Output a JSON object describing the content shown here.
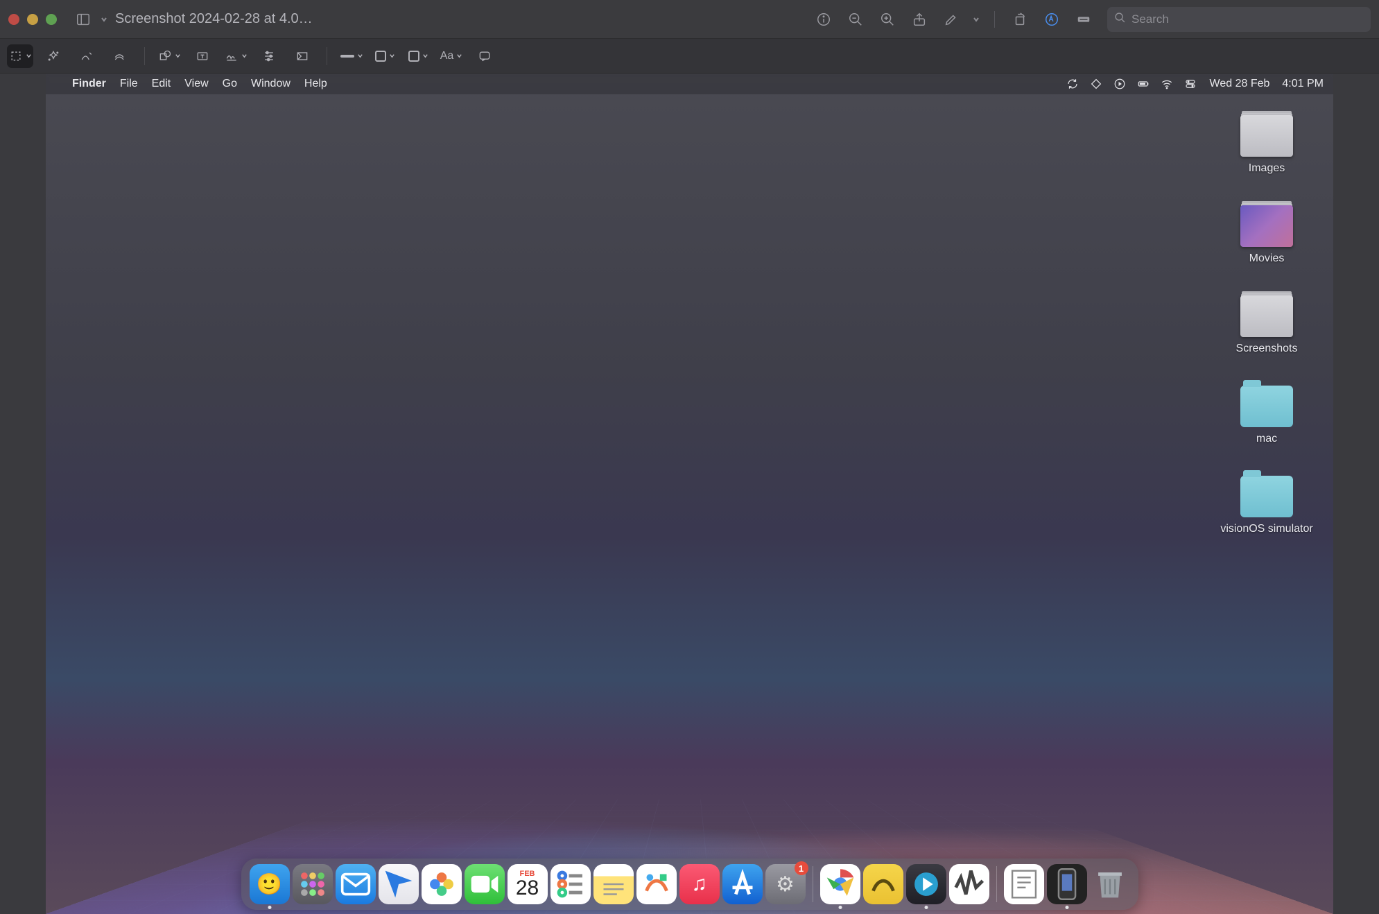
{
  "window": {
    "title": "Screenshot 2024-02-28 at 4.0…",
    "search_placeholder": "Search"
  },
  "menubar": {
    "app": "Finder",
    "items": [
      "File",
      "Edit",
      "View",
      "Go",
      "Window",
      "Help"
    ],
    "clock_date": "Wed 28 Feb",
    "clock_time": "4:01 PM"
  },
  "desktop_items": [
    {
      "label": "Images",
      "kind": "stack-images"
    },
    {
      "label": "Movies",
      "kind": "stack-movies"
    },
    {
      "label": "Screenshots",
      "kind": "stack-images"
    },
    {
      "label": "mac",
      "kind": "folder"
    },
    {
      "label": "visionOS simulator",
      "kind": "folder"
    }
  ],
  "calendar": {
    "month": "FEB",
    "day": "28"
  },
  "dock": {
    "badge_settings": "1",
    "items_left": [
      "finder",
      "launchpad",
      "mail",
      "maps",
      "photos",
      "facetime",
      "calendar",
      "reminders",
      "notes",
      "freeform",
      "music",
      "appstore",
      "settings"
    ],
    "items_mid": [
      "chrome",
      "freeform2",
      "quicktime",
      "activity-monitor"
    ],
    "items_right": [
      "textedit",
      "simulator",
      "trash"
    ]
  }
}
